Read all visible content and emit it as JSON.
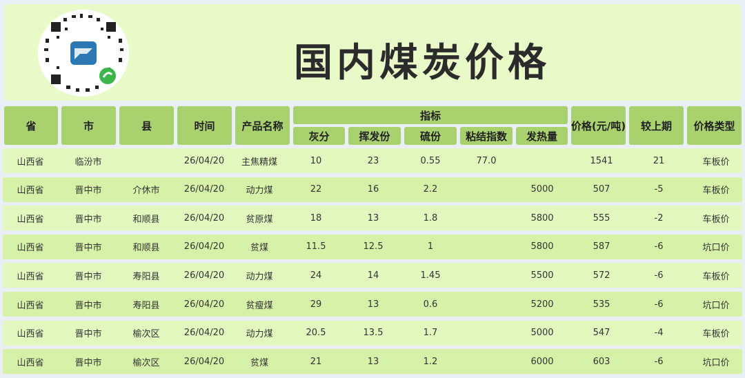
{
  "title": "国内煤炭价格",
  "header": {
    "province": "省",
    "city": "市",
    "county": "县",
    "date": "时间",
    "product": "产品名称",
    "indicators": "指标",
    "ash": "灰分",
    "volatile": "挥发份",
    "sulfur": "硫份",
    "caking": "粘结指数",
    "calorific": "发热量",
    "price": "价格(元/吨)",
    "change": "较上期",
    "price_type": "价格类型"
  },
  "rows": [
    [
      "山西省",
      "临汾市",
      "",
      "26/04/20",
      "主焦精煤",
      "10",
      "23",
      "0.55",
      "77.0",
      "",
      "1541",
      "21",
      "车板价"
    ],
    [
      "山西省",
      "晋中市",
      "介休市",
      "26/04/20",
      "动力煤",
      "22",
      "16",
      "2.2",
      "",
      "5000",
      "507",
      "-5",
      "车板价"
    ],
    [
      "山西省",
      "晋中市",
      "和顺县",
      "26/04/20",
      "贫原煤",
      "18",
      "13",
      "1.8",
      "",
      "5800",
      "555",
      "-2",
      "车板价"
    ],
    [
      "山西省",
      "晋中市",
      "和顺县",
      "26/04/20",
      "贫煤",
      "11.5",
      "12.5",
      "1",
      "",
      "5800",
      "587",
      "-6",
      "坑口价"
    ],
    [
      "山西省",
      "晋中市",
      "寿阳县",
      "26/04/20",
      "动力煤",
      "24",
      "14",
      "1.45",
      "",
      "5500",
      "572",
      "-6",
      "车板价"
    ],
    [
      "山西省",
      "晋中市",
      "寿阳县",
      "26/04/20",
      "贫瘦煤",
      "29",
      "13",
      "0.6",
      "",
      "5200",
      "535",
      "-6",
      "坑口价"
    ],
    [
      "山西省",
      "晋中市",
      "榆次区",
      "26/04/20",
      "动力煤",
      "20.5",
      "13.5",
      "1.7",
      "",
      "5000",
      "547",
      "-4",
      "车板价"
    ],
    [
      "山西省",
      "晋中市",
      "榆次区",
      "26/04/20",
      "贫煤",
      "21",
      "13",
      "1.2",
      "",
      "6000",
      "603",
      "-6",
      "坑口价"
    ]
  ]
}
